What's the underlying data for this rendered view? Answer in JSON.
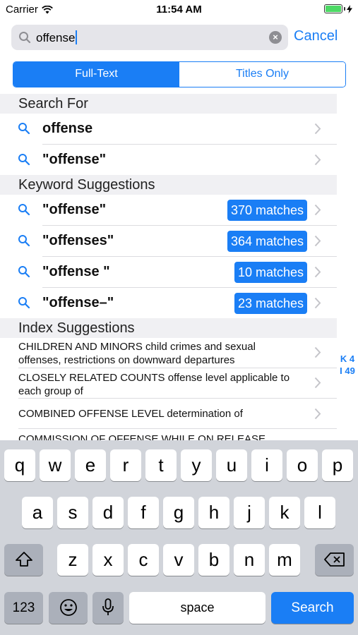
{
  "status": {
    "carrier": "Carrier",
    "time": "11:54 AM"
  },
  "search": {
    "query": "offense",
    "cancel_label": "Cancel"
  },
  "segments": {
    "full_text": "Full-Text",
    "titles_only": "Titles Only",
    "selected": "Full-Text"
  },
  "search_for": {
    "header": "Search For",
    "items": [
      {
        "label": "offense"
      },
      {
        "label": "\"offense\""
      }
    ]
  },
  "keyword_suggestions": {
    "header": "Keyword Suggestions",
    "items": [
      {
        "label": "\"offense\"",
        "badge": "370 matches"
      },
      {
        "label": "\"offenses\"",
        "badge": "364 matches"
      },
      {
        "label": "\"offense \"",
        "badge": "10 matches"
      },
      {
        "label": "\"offense–\"",
        "badge": "23 matches"
      }
    ]
  },
  "index_suggestions": {
    "header": "Index Suggestions",
    "items": [
      {
        "text": "CHILDREN AND MINORS child crimes and sexual offenses, restrictions on downward departures"
      },
      {
        "text": "CLOSELY RELATED COUNTS offense level applicable to each group of"
      },
      {
        "text": "COMBINED OFFENSE LEVEL determination of"
      },
      {
        "text": "COMMISSION OF OFFENSE WHILE ON RELEASE"
      }
    ]
  },
  "side_index": {
    "line1": "K 4",
    "line2": "I 49"
  },
  "keyboard": {
    "row1": [
      "q",
      "w",
      "e",
      "r",
      "t",
      "y",
      "u",
      "i",
      "o",
      "p"
    ],
    "row2": [
      "a",
      "s",
      "d",
      "f",
      "g",
      "h",
      "j",
      "k",
      "l"
    ],
    "row3": [
      "z",
      "x",
      "c",
      "v",
      "b",
      "n",
      "m"
    ],
    "numbers_label": "123",
    "space_label": "space",
    "search_label": "Search"
  },
  "colors": {
    "accent": "#1a7ef5",
    "keyboard_bg": "#d1d4da"
  }
}
